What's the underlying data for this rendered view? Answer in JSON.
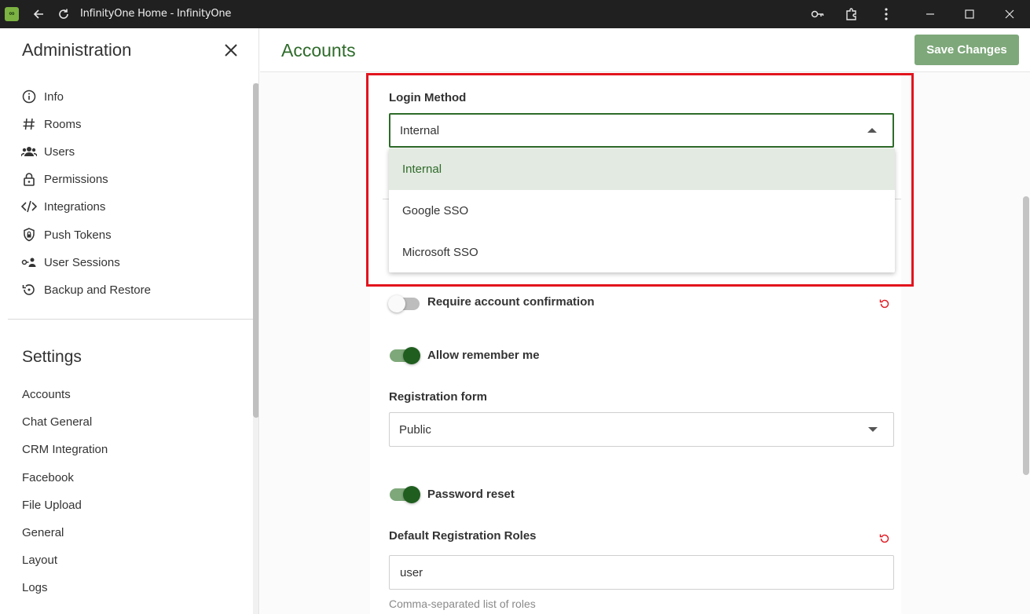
{
  "window": {
    "title": "InfinityOne Home - InfinityOne",
    "app_icon_text": "∞"
  },
  "sidebar": {
    "title": "Administration",
    "admin_items": [
      {
        "label": "Info",
        "icon": "info-icon"
      },
      {
        "label": "Rooms",
        "icon": "hash-icon"
      },
      {
        "label": "Users",
        "icon": "users-icon"
      },
      {
        "label": "Permissions",
        "icon": "lock-icon"
      },
      {
        "label": "Integrations",
        "icon": "code-icon"
      },
      {
        "label": "Push Tokens",
        "icon": "shield-icon"
      },
      {
        "label": "User Sessions",
        "icon": "user-sessions-icon"
      },
      {
        "label": "Backup and Restore",
        "icon": "restore-icon"
      }
    ],
    "settings_title": "Settings",
    "settings_items": [
      "Accounts",
      "Chat General",
      "CRM Integration",
      "Facebook",
      "File Upload",
      "General",
      "Layout",
      "Logs"
    ]
  },
  "main": {
    "title": "Accounts",
    "save_label": "Save Changes",
    "login_method": {
      "label": "Login Method",
      "value": "Internal",
      "options": [
        "Internal",
        "Google SSO",
        "Microsoft SSO"
      ],
      "selected_index": 0
    },
    "require_confirmation": {
      "label": "Require account confirmation",
      "on": false
    },
    "allow_remember": {
      "label": "Allow remember me",
      "on": true
    },
    "registration_form": {
      "label": "Registration form",
      "value": "Public"
    },
    "password_reset": {
      "label": "Password reset",
      "on": true
    },
    "default_roles": {
      "label": "Default Registration Roles",
      "value": "user",
      "hint": "Comma-separated list of roles"
    }
  },
  "colors": {
    "accent": "#2e6b2a",
    "save_button": "#7ea87a",
    "highlight": "#e2141d",
    "titlebar": "#202020"
  }
}
